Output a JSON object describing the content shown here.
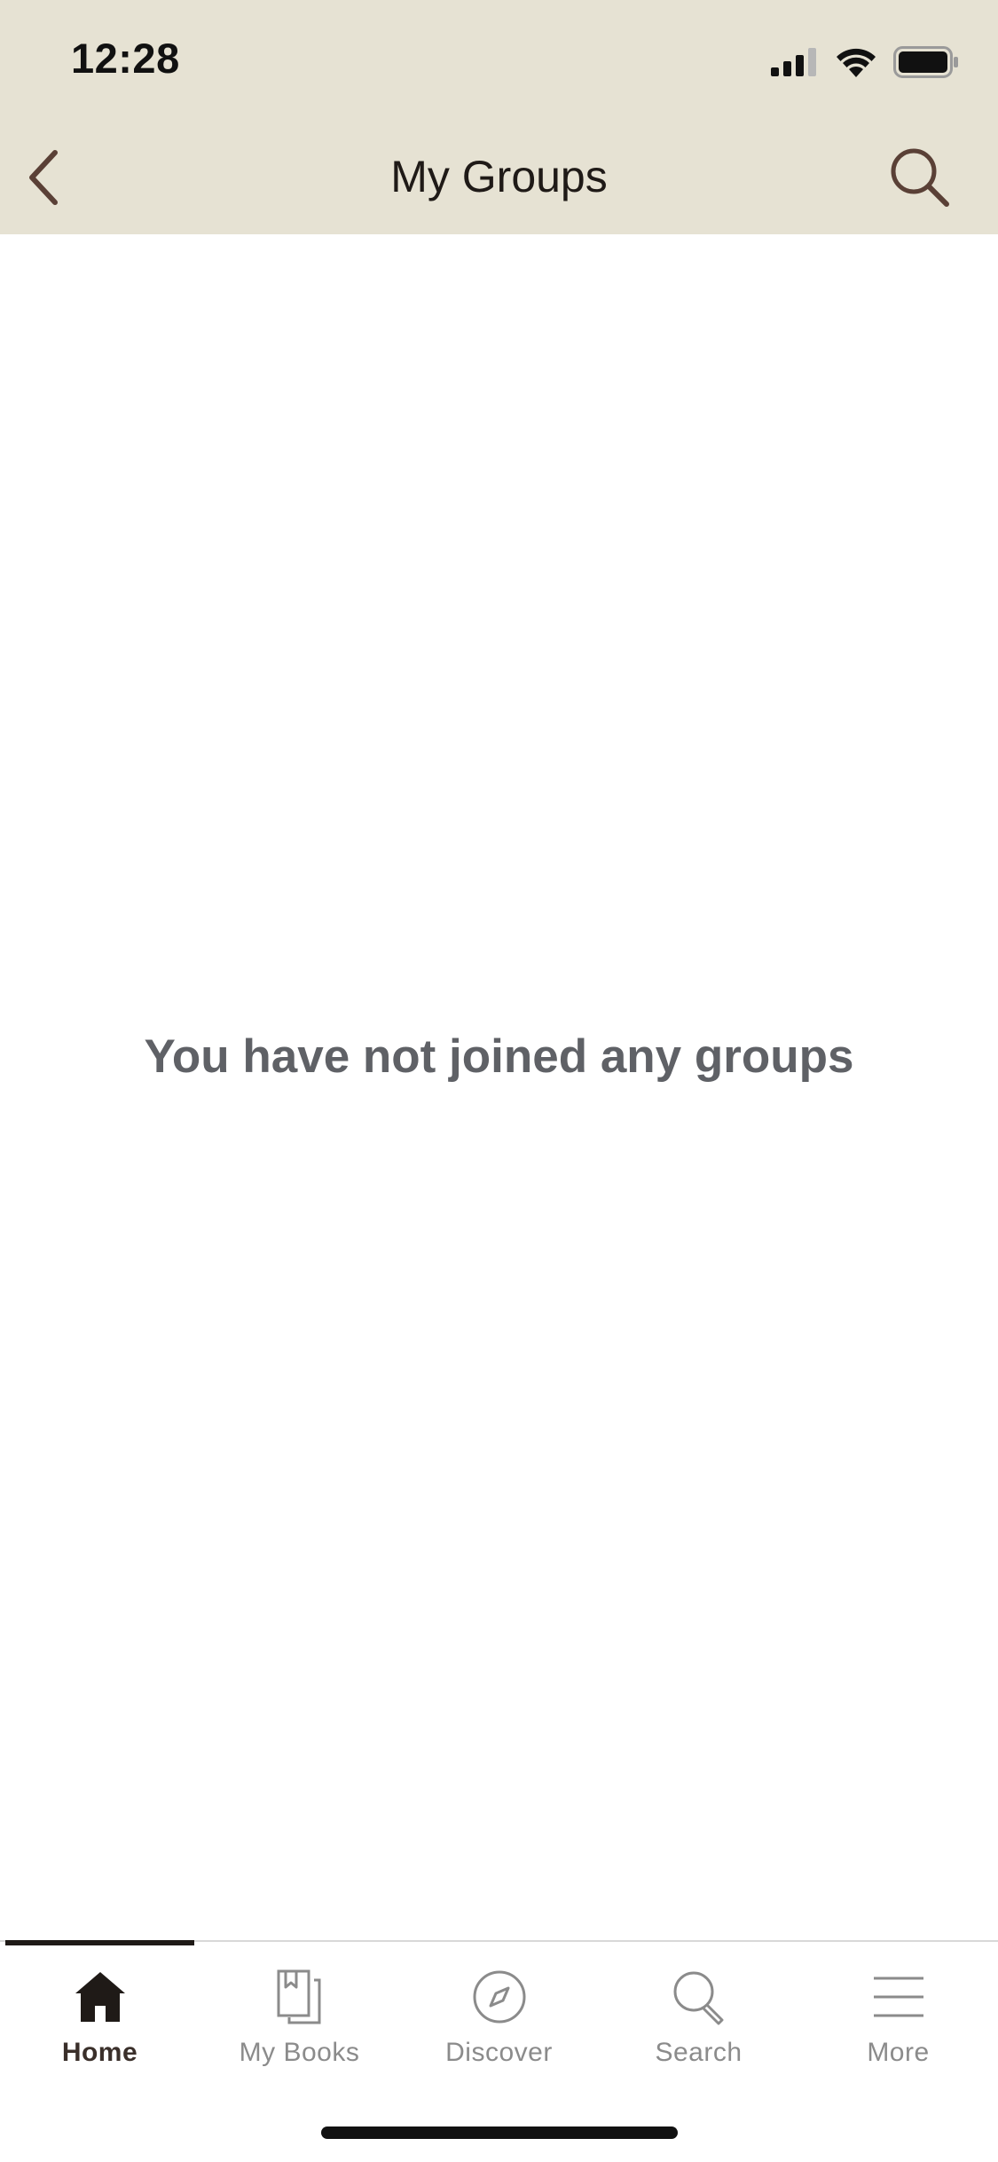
{
  "status_bar": {
    "time": "12:28",
    "icons": [
      "cellular-signal-icon",
      "wifi-icon",
      "battery-icon"
    ]
  },
  "nav": {
    "title": "My Groups",
    "back_icon": "chevron-left-icon",
    "search_icon": "search-icon"
  },
  "main": {
    "empty_message": "You have not joined any groups"
  },
  "tabbar": {
    "active": "Home",
    "tabs": [
      {
        "label": "Home",
        "icon": "home-icon"
      },
      {
        "label": "My Books",
        "icon": "books-icon"
      },
      {
        "label": "Discover",
        "icon": "compass-icon"
      },
      {
        "label": "Search",
        "icon": "search-icon"
      },
      {
        "label": "More",
        "icon": "menu-icon"
      }
    ]
  },
  "colors": {
    "header_bg": "#e6e2d3",
    "accent": "#5a4036",
    "active_text": "#3a2f2a",
    "inactive_text": "#8b8b8b",
    "message_text": "#5f6166"
  }
}
